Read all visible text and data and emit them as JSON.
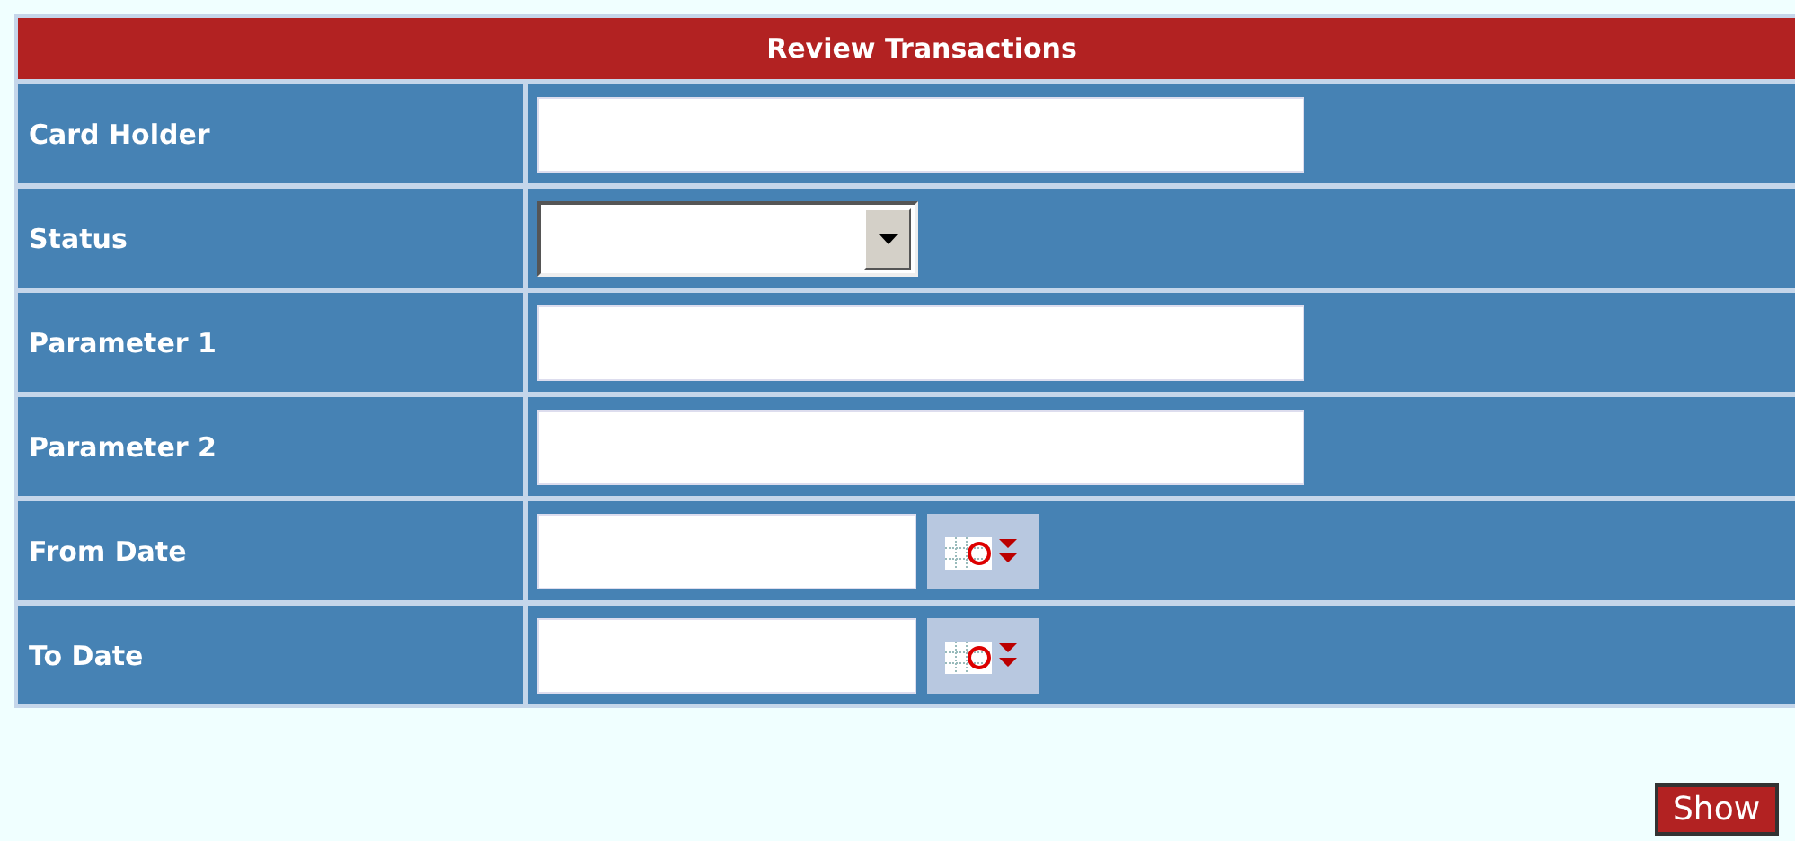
{
  "form": {
    "title": "Review Transactions",
    "fields": [
      {
        "label": "Card Holder",
        "kind": "text"
      },
      {
        "label": "Status",
        "kind": "select"
      },
      {
        "label": "Parameter 1",
        "kind": "text"
      },
      {
        "label": "Parameter 2",
        "kind": "text"
      },
      {
        "label": "From Date",
        "kind": "date"
      },
      {
        "label": "To Date",
        "kind": "date"
      }
    ]
  },
  "buttons": [
    "Show"
  ]
}
